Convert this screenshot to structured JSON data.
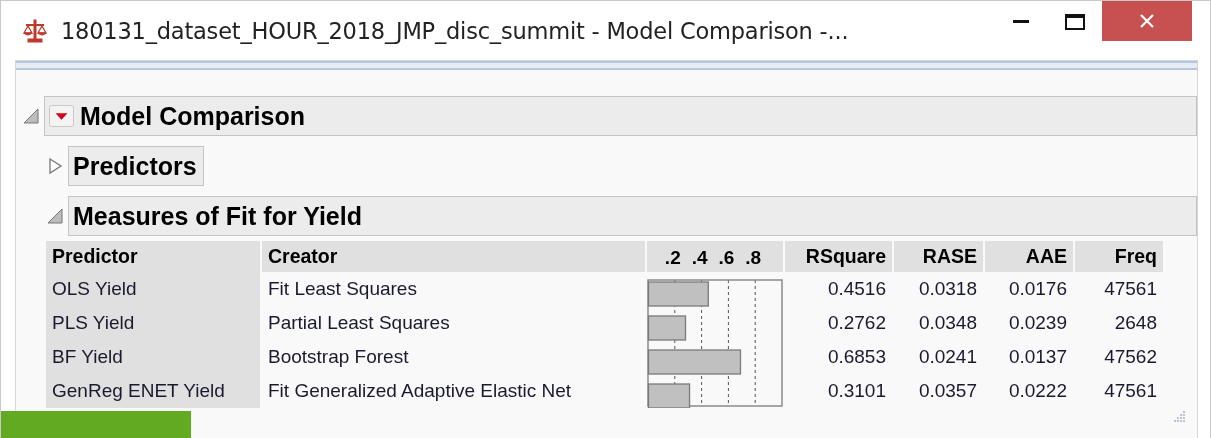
{
  "window": {
    "title": "180131_dataset_HOUR_2018_JMP_disc_summit - Model Comparison -..."
  },
  "report": {
    "title": "Model Comparison",
    "expanded": true,
    "has_menu": true,
    "sections": [
      {
        "title": "Predictors",
        "expanded": false
      },
      {
        "title": "Measures of Fit for Yield",
        "expanded": true,
        "table": {
          "columns": [
            "Predictor",
            "Creator",
            "RSquare",
            "RASE",
            "AAE",
            "Freq"
          ],
          "rows": [
            {
              "predictor": "OLS Yield",
              "creator": "Fit Least Squares",
              "rsquare": "0.4516",
              "rase": "0.0318",
              "aae": "0.0176",
              "freq": "47561"
            },
            {
              "predictor": "PLS Yield",
              "creator": "Partial Least Squares",
              "rsquare": "0.2762",
              "rase": "0.0348",
              "aae": "0.0239",
              "freq": "2648"
            },
            {
              "predictor": "BF Yield",
              "creator": "Bootstrap Forest",
              "rsquare": "0.6853",
              "rase": "0.0241",
              "aae": "0.0137",
              "freq": "47562"
            },
            {
              "predictor": "GenReg ENET Yield",
              "creator": "Fit Generalized Adaptive Elastic Net",
              "rsquare": "0.3101",
              "rase": "0.0357",
              "aae": "0.0222",
              "freq": "47561"
            }
          ],
          "chart_data": {
            "type": "bar",
            "orientation": "horizontal",
            "grid": true,
            "values": [
              0.45,
              0.28,
              0.69,
              0.31
            ],
            "xlim": [
              0,
              1
            ],
            "xticks": [
              {
                "value": 0.2,
                "label": ".2"
              },
              {
                "value": 0.4,
                "label": ".4"
              },
              {
                "value": 0.6,
                "label": ".6"
              },
              {
                "value": 0.8,
                "label": ".8"
              }
            ]
          }
        }
      }
    ]
  }
}
